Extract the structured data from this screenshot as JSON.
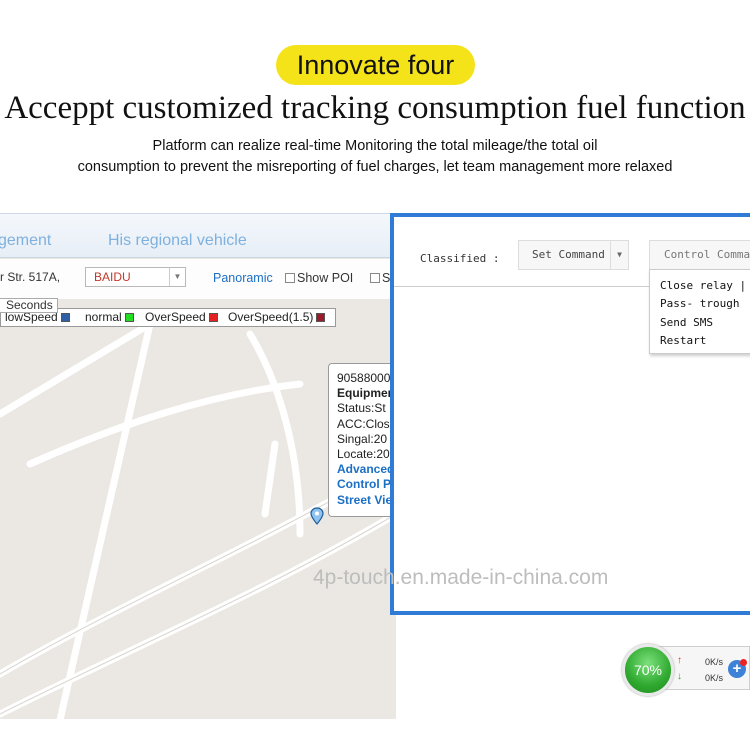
{
  "header": {
    "badge": "Innovate four",
    "title": "Acceppt customized tracking consumption fuel function",
    "description_line1": "Platform can realize real-time Monitoring  the total mileage/the total oil",
    "description_line2": "consumption to prevent the misreporting of fuel charges, let team management more relaxed"
  },
  "map": {
    "tabs": [
      "gement",
      "His regional vehicle"
    ],
    "address": "r Str. 517A,",
    "map_provider": "BAIDU",
    "panoramic_label": "Panoramic",
    "show_poi_label": "Show POI",
    "show_s_label": "S",
    "seconds_label": "Seconds",
    "legend": [
      {
        "label": "lowSpeed",
        "color": "#2f5fa8"
      },
      {
        "label": "normal",
        "color": "#22dd22"
      },
      {
        "label": "OverSpeed",
        "color": "#e52222"
      },
      {
        "label": "OverSpeed(1.5)",
        "color": "#9a1b2b"
      }
    ],
    "popup": {
      "id": "90588000",
      "equipment": "Equipmen",
      "status": "Status:St",
      "acc": "ACC:Clos",
      "signal": "Singal:20",
      "locate": "Locate:20",
      "links": [
        "Advanced",
        "Control P",
        "Street Vie"
      ]
    }
  },
  "command": {
    "classified_label": "Classified :",
    "set_command": "Set Command",
    "control_command": "Control Commad",
    "menu": [
      "Close relay | Op",
      "Pass- trough",
      "Send SMS",
      "Restart"
    ]
  },
  "watermark": "4p-touch.en.made-in-china.com",
  "speed_widget": {
    "percent": "70%",
    "upload": "0K/s",
    "download": "0K/s",
    "accent": "#2fa92f"
  }
}
